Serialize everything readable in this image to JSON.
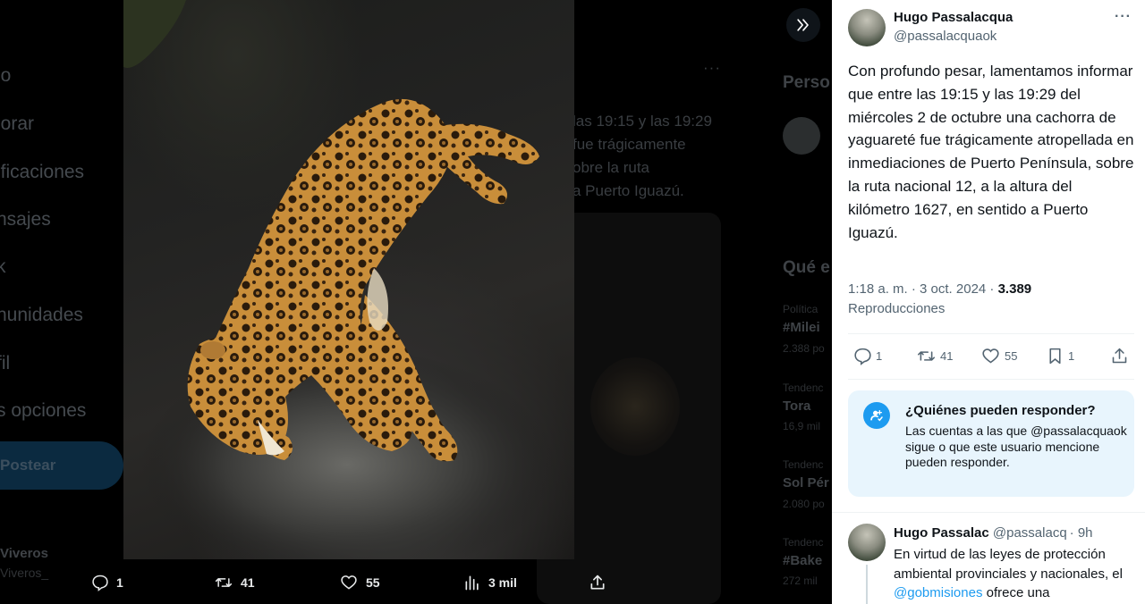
{
  "background": {
    "nav_items": [
      "io",
      "lorar",
      "ificaciones",
      "nsajes",
      "k",
      "nunidades",
      "fil",
      "s opciones"
    ],
    "post_button": "Postear",
    "user_name": "Viveros",
    "user_handle": "Viveros_",
    "feed_text_lines": [
      "las 19:15 y las 19:29",
      "fue trágicamente",
      "obre la ruta",
      "a Puerto Iguazú."
    ],
    "right_title_1": "Perso",
    "right_title_2": "Qué e",
    "trends": [
      {
        "context": "Política",
        "tag": "#Milei",
        "count": "2.388 po"
      },
      {
        "context": "Tendenc",
        "tag": "Tora",
        "count": "16,9 mil"
      },
      {
        "context": "Tendenc",
        "tag": "Sol Pér",
        "count": "2.080 po"
      },
      {
        "context": "Tendenc",
        "tag": "#Bake",
        "count": "272 mil"
      }
    ]
  },
  "media_bar": {
    "reply_count": "1",
    "retweet_count": "41",
    "like_count": "55",
    "views_count": "3 mil"
  },
  "tweet": {
    "author_name": "Hugo Passalacqua",
    "author_handle": "@passalacquaok",
    "text": "Con profundo pesar, lamentamos informar que entre las 19:15 y las 19:29 del miércoles 2 de octubre una cachorra de yaguareté fue trágicamente atropellada en inmediaciones de Puerto Península, sobre la ruta nacional 12, a la altura del kilómetro 1627, en sentido a Puerto Iguazú.",
    "time": "1:18 a. m. · 3 oct. 2024 · ",
    "views": "3.389",
    "views_label": "Reproducciones",
    "stats": {
      "replies": "1",
      "retweets": "41",
      "likes": "55",
      "bookmarks": "1"
    }
  },
  "reply_restriction": {
    "title": "¿Quiénes pueden responder?",
    "body": "Las cuentas a las que @passalacquaok sigue o que este usuario mencione pueden responder."
  },
  "reply_tweet": {
    "author_name": "Hugo Passalac",
    "author_handle_time": "@passalacq · 9h",
    "text_before_link": "En virtud de las leyes de protección ambiental provinciales y nacionales, el ",
    "link_text": "@gobmisiones",
    "text_after_link": " ofrece una"
  },
  "colors": {
    "accent": "#1d9bf0",
    "text_primary": "#0f1419",
    "text_secondary": "#536471",
    "reply_box_bg": "#e8f5fd"
  },
  "icons": [
    "expand-icon",
    "more-icon",
    "reply-icon",
    "retweet-icon",
    "like-icon",
    "bookmark-icon",
    "share-icon",
    "views-icon",
    "person-check-icon"
  ]
}
